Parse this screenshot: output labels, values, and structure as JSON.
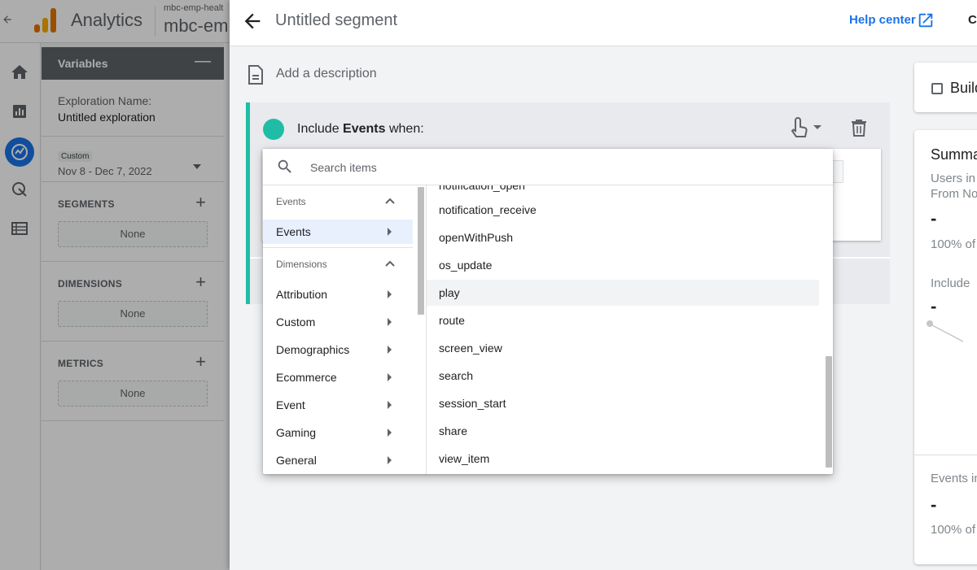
{
  "background": {
    "app_title": "Analytics",
    "property_small": "mbc-emp-healt",
    "property_big": "mbc-em",
    "variables": {
      "header": "Variables",
      "exploration_name_label": "Exploration Name:",
      "exploration_name_value": "Untitled exploration",
      "date_chip": "Custom",
      "date_range": "Nov 8 - Dec 7, 2022",
      "segments_label": "SEGMENTS",
      "segments_none": "None",
      "dimensions_label": "DIMENSIONS",
      "dimensions_none": "None",
      "metrics_label": "METRICS",
      "metrics_none": "None"
    }
  },
  "panel": {
    "title": "Untitled segment",
    "help_center": "Help center",
    "truncated_action": "C",
    "description_placeholder": "Add a description",
    "condition": {
      "prefix": "Include",
      "bold": "Events",
      "suffix": "when:"
    },
    "summary_top_label": "Build",
    "summary": {
      "title": "Summa",
      "users_line1": "Users in",
      "users_line2": "From No",
      "users_value": "-",
      "users_pct": "100% of",
      "include_label": "Include",
      "include_value": "-",
      "events_label": "Events in",
      "events_value": "-",
      "events_pct": "100% of"
    }
  },
  "dropdown": {
    "search_placeholder": "Search items",
    "categories": [
      {
        "type": "header",
        "label": "Events"
      },
      {
        "type": "item",
        "label": "Events",
        "selected": true
      },
      {
        "type": "header",
        "label": "Dimensions"
      },
      {
        "type": "item",
        "label": "Attribution"
      },
      {
        "type": "item",
        "label": "Custom"
      },
      {
        "type": "item",
        "label": "Demographics"
      },
      {
        "type": "item",
        "label": "Ecommerce"
      },
      {
        "type": "item",
        "label": "Event"
      },
      {
        "type": "item",
        "label": "Gaming"
      },
      {
        "type": "item",
        "label": "General"
      }
    ],
    "events": [
      "notification_open",
      "notification_receive",
      "openWithPush",
      "os_update",
      "play",
      "route",
      "screen_view",
      "search",
      "session_start",
      "share",
      "view_item"
    ],
    "hovered_event": "play"
  },
  "colors": {
    "accent": "#1a73e8",
    "segment_teal": "#1fbda6"
  }
}
